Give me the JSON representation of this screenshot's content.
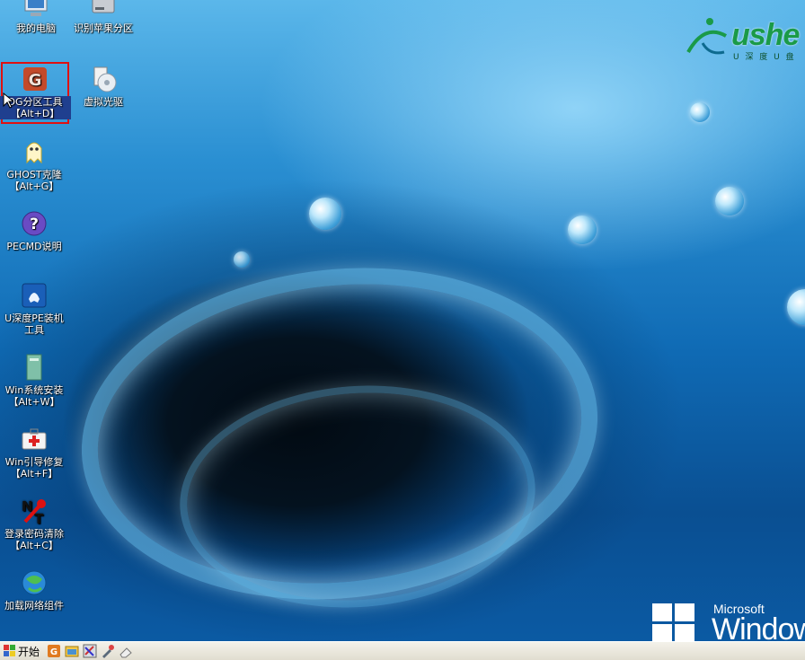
{
  "desktop_icons": {
    "my_computer": "我的电脑",
    "apple_partition": "识别苹果分区",
    "dg_tool": "DG分区工具",
    "dg_tool_key": "【Alt+D】",
    "virtual_cd": "虚拟光驱",
    "ghost": "GHOST克隆",
    "ghost_key": "【Alt+G】",
    "pecmd_help": "PECMD说明",
    "pe_tool_line1": "U深度PE装机",
    "pe_tool_line2": "工具",
    "win_install": "Win系统安装",
    "win_install_key": "【Alt+W】",
    "win_boot_fix": "Win引导修复",
    "win_boot_fix_key": "【Alt+F】",
    "pwd_clear": "登录密码清除",
    "pwd_clear_key": "【Alt+C】",
    "net_component": "加载网络组件"
  },
  "logo": {
    "brand": "ushe",
    "sub": "U 深 度 U 盘"
  },
  "wallpaper": {
    "ms": "Microsoft",
    "win": "Window"
  },
  "taskbar": {
    "start_label": "开始"
  },
  "colors": {
    "selection_border": "#e01010",
    "logo_green": "#1a9a48"
  }
}
